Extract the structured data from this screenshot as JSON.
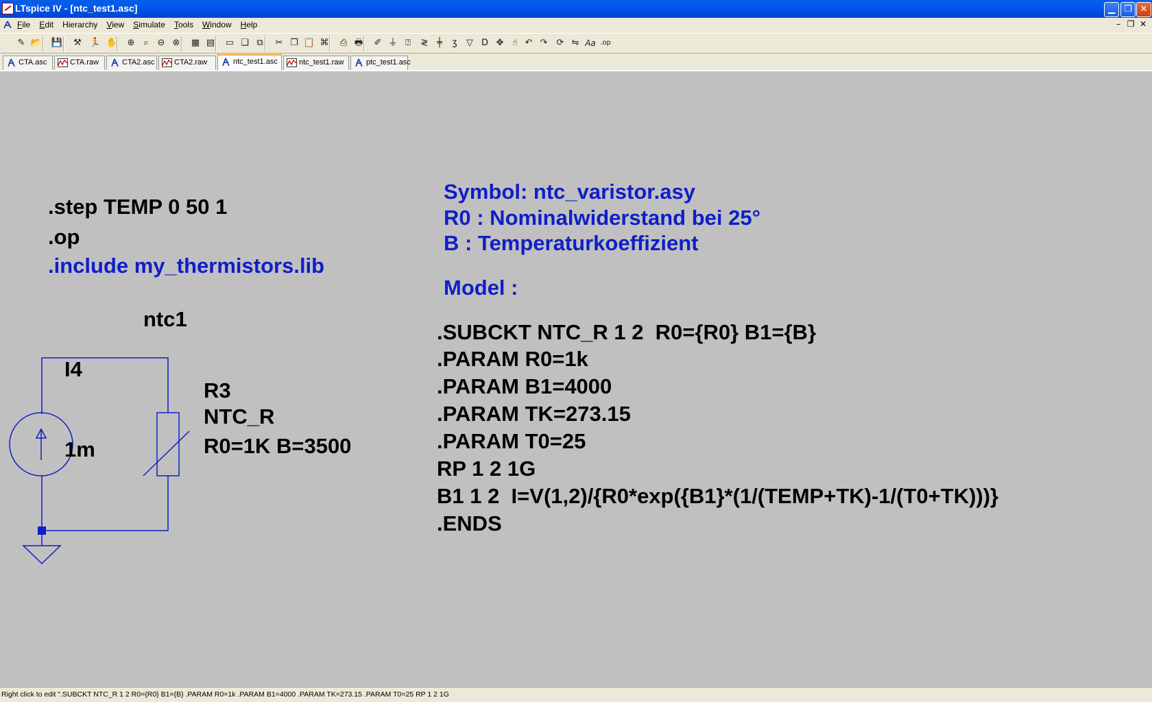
{
  "window": {
    "title": "LTspice IV - [ntc_test1.asc]",
    "minimize_glyph": "▁",
    "restore_glyph": "❐",
    "close_glyph": "✕"
  },
  "menu": {
    "items": [
      {
        "ul": "F",
        "rest": "ile"
      },
      {
        "ul": "E",
        "rest": "dit"
      },
      {
        "ul": "",
        "rest": "Hierarchy"
      },
      {
        "ul": "V",
        "rest": "iew"
      },
      {
        "ul": "S",
        "rest": "imulate"
      },
      {
        "ul": "T",
        "rest": "ools"
      },
      {
        "ul": "W",
        "rest": "indow"
      },
      {
        "ul": "H",
        "rest": "elp"
      }
    ],
    "mdi_controls": [
      "–",
      "❐",
      "✕"
    ]
  },
  "toolbar": {
    "icons": [
      "new-schematic",
      "open",
      "save",
      "control-panel",
      "run",
      "halt",
      "zoom-in",
      "zoom-pan",
      "zoom-out",
      "zoom-fit",
      "autorange",
      "grid",
      "tile",
      "cascade",
      "close-window",
      "cut",
      "copy",
      "paste",
      "find",
      "print-setup",
      "print",
      "wire",
      "ground",
      "label-net",
      "resistor",
      "capacitor",
      "inductor",
      "diode",
      "component",
      "move",
      "drag",
      "undo",
      "redo",
      "rotate",
      "mirror",
      "text",
      "spice-directive"
    ],
    "text_icon_label": "Aa",
    "op_icon_label": ".op"
  },
  "tabs": [
    {
      "label": "CTA.asc",
      "kind": "schematic"
    },
    {
      "label": "CTA.raw",
      "kind": "waveform"
    },
    {
      "label": "CTA2.asc",
      "kind": "schematic"
    },
    {
      "label": "CTA2.raw",
      "kind": "waveform"
    },
    {
      "label": "ntc_test1.asc",
      "kind": "schematic",
      "active": true
    },
    {
      "label": "ntc_test1.raw",
      "kind": "waveform"
    },
    {
      "label": "ptc_test1.asc",
      "kind": "schematic"
    }
  ],
  "schematic": {
    "directives": {
      "step": ".step TEMP 0 50 1",
      "op": ".op",
      "include": ".include my_thermistors.lib"
    },
    "comments": {
      "symbol": "Symbol: ntc_varistor.asy",
      "r0": "R0 : Nominalwiderstand bei 25°",
      "b": "B : Temperaturkoeffizient",
      "model": "Model :"
    },
    "model_lines": [
      ".SUBCKT NTC_R 1 2  R0={R0} B1={B}",
      ".PARAM R0=1k",
      ".PARAM B1=4000",
      ".PARAM TK=273.15",
      ".PARAM T0=25",
      "RP 1 2 1G",
      "B1 1 2  I=V(1,2)/{R0*exp({B1}*(1/(TEMP+TK)-1/(T0+TK)))}",
      ".ENDS"
    ],
    "labels": {
      "net": "ntc1",
      "source_name": "I4",
      "source_value": "1m",
      "res_name": "R3",
      "res_value": "NTC_R",
      "res_params": "R0=1K B=3500"
    },
    "colors": {
      "background": "#c0c0c0",
      "wire": "#0f1ec8",
      "text_black": "#000000",
      "text_blue": "#0f1ec8"
    }
  },
  "status": {
    "text": "Right click to edit \".SUBCKT NTC_R 1 2  R0={R0} B1={B}  .PARAM R0=1k  .PARAM B1=4000  .PARAM TK=273.15  .PARAM T0=25  RP 1 2 1G"
  }
}
